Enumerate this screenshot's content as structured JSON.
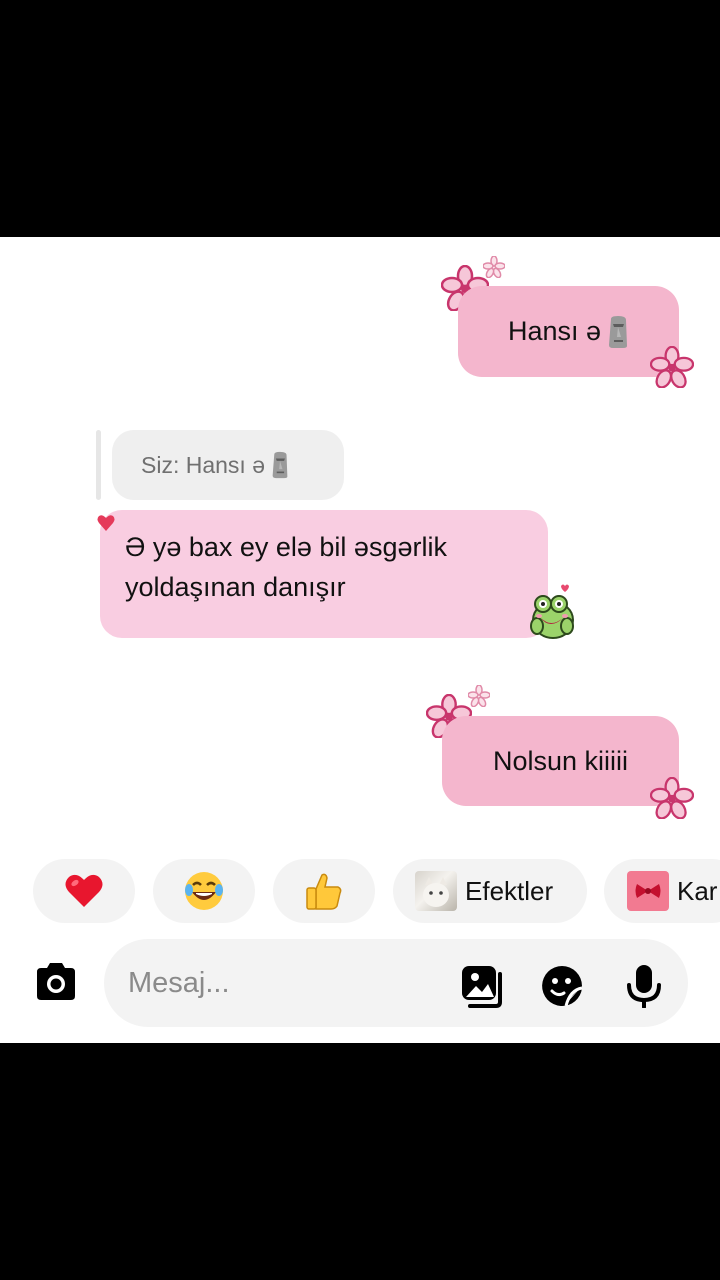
{
  "messages": [
    {
      "direction": "outgoing",
      "text": "Hansı ə",
      "emoji": "moai"
    },
    {
      "direction": "incoming",
      "reply_to": {
        "label": "Siz:",
        "text": "Hansı ə",
        "emoji": "moai"
      },
      "lines": [
        "Ə yə bax ey elə bil əsgərlik",
        "yoldaşınan danışır"
      ],
      "reaction": "heart",
      "sticker": "frog-blush"
    },
    {
      "direction": "outgoing",
      "text": "Nolsun kiiiii"
    }
  ],
  "quick_reactions": [
    {
      "emoji": "❤️",
      "icon": "heart-icon"
    },
    {
      "emoji": "😂",
      "icon": "laughing-face-icon"
    },
    {
      "emoji": "👍",
      "icon": "thumbs-up-icon"
    },
    {
      "label": "Efektler",
      "icon": "cat-thumbnail"
    },
    {
      "label": "Kar",
      "icon": "gift-icon"
    }
  ],
  "composer": {
    "placeholder": "Mesaj...",
    "icons": [
      "camera-icon",
      "gallery-icon",
      "sticker-icon",
      "microphone-icon"
    ]
  },
  "colors": {
    "outgoing_bubble": "#f4b6cd",
    "incoming_bubble": "#f9cde1",
    "reply_chip": "#efefef",
    "flower_accent": "#d6427a",
    "chip_background": "#f3f3f3"
  }
}
